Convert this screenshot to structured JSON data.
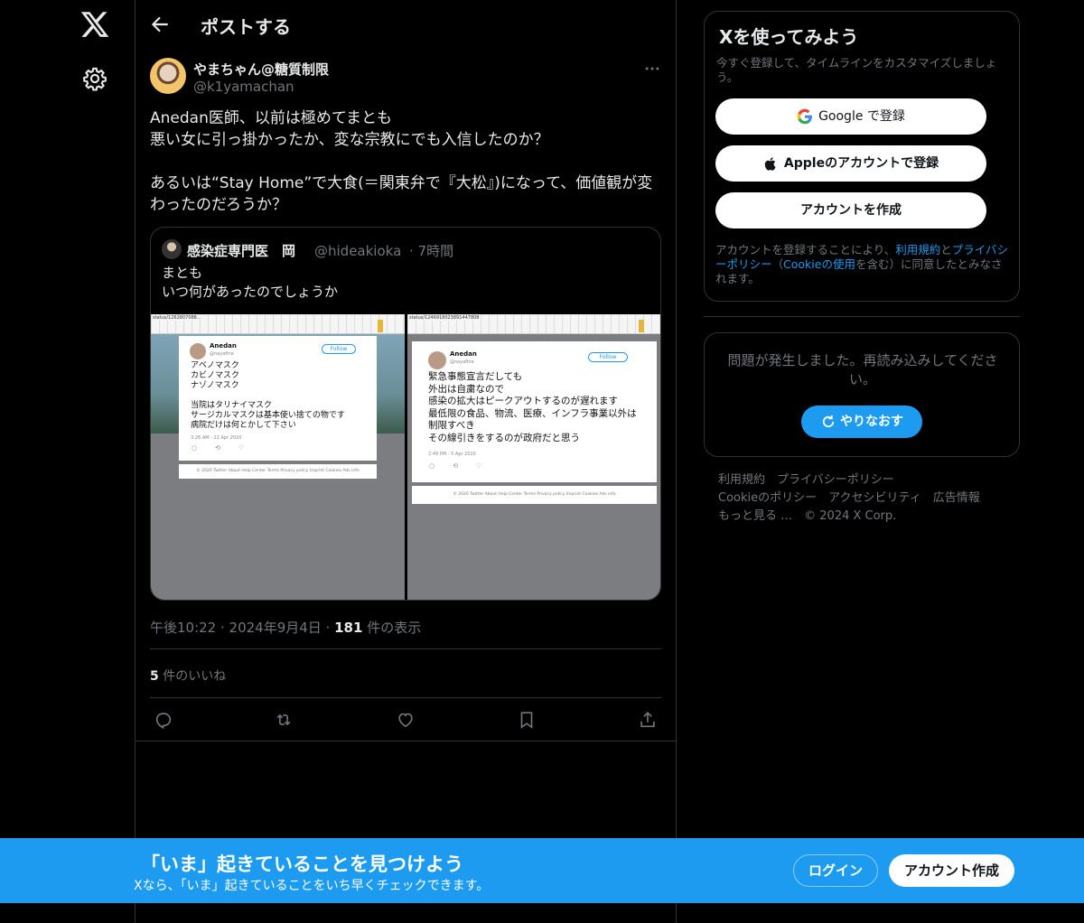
{
  "header": {
    "title": "ポストする"
  },
  "tweet": {
    "name": "やまちゃん@糖質制限",
    "handle": "@k1yamachan",
    "text": "Anedan医師、以前は極めてまとも\n悪い女に引っ掛かったか、変な宗教にでも入信したのか？\n\nあるいは“Stay Home”で大食(＝関東弁で『大松』)になって、価値観が変わったのだろうか？",
    "time": "午後10:22 · 2024年9月4日 · ",
    "views_count": "181",
    "views_label": " 件の表示",
    "likes_count": "5",
    "likes_label": " 件のいいね"
  },
  "quote": {
    "name": "感染症専門医　岡",
    "handle": "@hideakioka",
    "time": "· 7時間",
    "text": "まとも\nいつ何があったのでしょうか",
    "screenshots": [
      {
        "url": "status/1262807088...",
        "name": "Anedan",
        "handle": "@nayafine",
        "follow": "Follow",
        "text": "アベノマスク\nカビノマスク\nナゾノマスク\n\n当院はタリナイマスク\nサージカルマスクは基本使い捨ての物です\n病院だけは何とかして下さい",
        "date": "3:26 AM - 22 Apr 2020",
        "footer": "© 2020 Twitter   About   Help Center   Terms   Privacy policy   Imprint   Cookies   Ads info"
      },
      {
        "url": "status/1246918023891447808",
        "name": "Anedan",
        "handle": "@nayafine",
        "follow": "Follow",
        "text": "緊急事態宣言だしても\n外出は自粛なので\n感染の拡大はピークアウトするのが遅れます\n最低限の食品、物流、医療、インフラ事業以外は制限すべき\nその線引きをするのが政府だと思う",
        "date": "2:49 PM - 5 Apr 2020",
        "footer": "© 2020 Twitter   About   Help Center   Terms   Privacy policy   Imprint   Cookies   Ads info"
      }
    ]
  },
  "signup": {
    "title": "Xを使ってみよう",
    "subtitle": "今すぐ登録して、タイムラインをカスタマイズしましょう。",
    "google_label": "Google で登録",
    "apple_label": "Appleのアカウントで登録",
    "create_label": "アカウントを作成",
    "legal_prefix": "アカウントを登録することにより、",
    "legal_terms": "利用規約",
    "legal_and": "と",
    "legal_privacy": "プライバシーポリシー",
    "legal_paren_open": "（",
    "legal_cookie": "Cookieの使用",
    "legal_suffix": "を含む）に同意したとみなされます。"
  },
  "error_panel": {
    "message": "問題が発生しました。再読み込みしてください。",
    "retry_label": "やりなおす"
  },
  "footer_links": [
    "利用規約",
    "プライバシーポリシー",
    "Cookieのポリシー",
    "アクセシビリティ",
    "広告情報",
    "もっと見る …",
    "© 2024 X Corp."
  ],
  "banner": {
    "title": "「いま」起きていることを見つけよう",
    "subtitle": "Xなら、「いま」起きていることをいち早くチェックできます。",
    "login_label": "ログイン",
    "signup_label": "アカウント作成"
  },
  "colors": {
    "accent": "#1d9bf0",
    "background": "#000000",
    "border": "#2f3336",
    "muted": "#71767b",
    "text": "#e7e9ea"
  },
  "icons": [
    "x-logo-icon",
    "gear-icon",
    "back-arrow-icon",
    "more-icon",
    "reply-icon",
    "repost-icon",
    "like-icon",
    "bookmark-icon",
    "share-icon",
    "google-icon",
    "apple-icon",
    "refresh-icon"
  ]
}
